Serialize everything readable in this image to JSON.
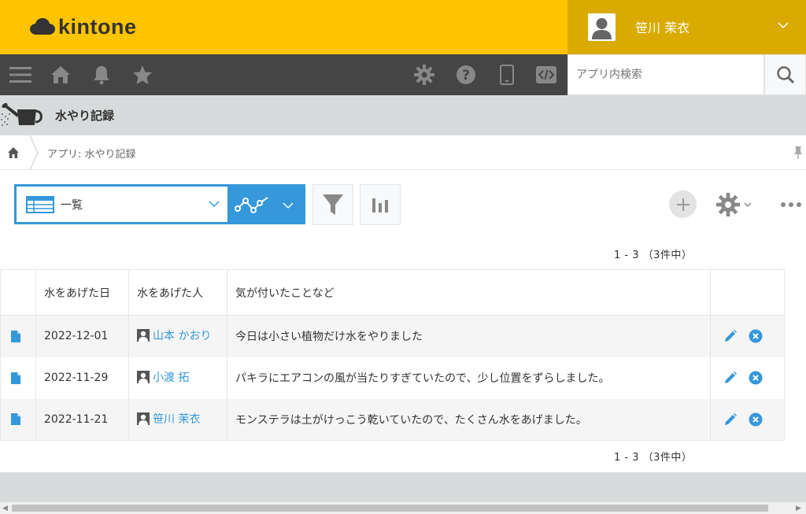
{
  "brand": {
    "name": "kintone",
    "color": "#ffc400"
  },
  "user": {
    "name": "笹川 茉衣"
  },
  "toolbar": {
    "left_icons": [
      "menu-icon",
      "home-icon",
      "bell-icon",
      "star-icon"
    ],
    "right_icons": [
      "gear-icon",
      "help-icon",
      "mobile-icon",
      "code-icon"
    ]
  },
  "search": {
    "placeholder": "アプリ内検索",
    "value": ""
  },
  "app": {
    "title": "水やり記録"
  },
  "breadcrumb": {
    "text": "アプリ: 水やり記録"
  },
  "view": {
    "name": "一覧"
  },
  "pager": {
    "top": "1 - 3 （3件中）",
    "bottom": "1 - 3 （3件中）"
  },
  "table": {
    "columns": [
      "水をあげた日",
      "水をあげた人",
      "気が付いたことなど"
    ],
    "rows": [
      {
        "date": "2022-12-01",
        "person": "山本 かおり",
        "note": "今日は小さい植物だけ水をやりました"
      },
      {
        "date": "2022-11-29",
        "person": "小渡 拓",
        "note": "パキラにエアコンの風が当たりすぎていたので、少し位置をずらしました。"
      },
      {
        "date": "2022-11-21",
        "person": "笹川 茉衣",
        "note": "モンステラは土がけっこう乾いていたので、たくさん水をあげました。"
      }
    ]
  },
  "colors": {
    "accent": "#3498db",
    "toolbar": "#454545",
    "user_area": "#d9aa00"
  }
}
